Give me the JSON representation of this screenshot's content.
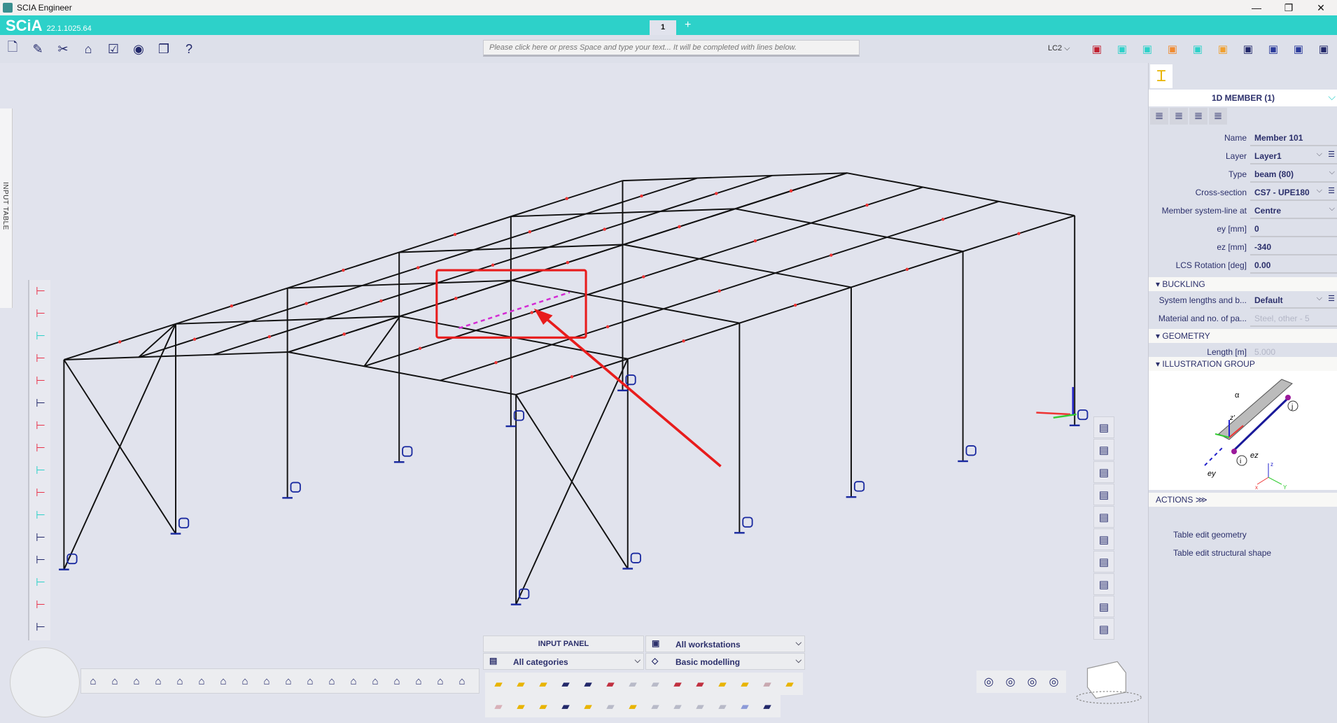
{
  "window": {
    "title": "SCIA Engineer",
    "controls": [
      "—",
      "❐",
      "✕"
    ]
  },
  "brand": {
    "name": "SCiA",
    "version": "22.1.1025.64"
  },
  "tabs": [
    {
      "label": "1"
    },
    {
      "label": "+"
    }
  ],
  "toolbar": {
    "left_icons": [
      "new-document-icon",
      "edit-project-icon",
      "tools-icon",
      "structure-icon",
      "check-icon",
      "view-icon",
      "open-book-icon",
      "help-icon"
    ],
    "command_placeholder": "Please click here or press Space and type your text... It will be completed with lines below.",
    "load_case": "LC2",
    "right_icons": [
      "snap-icon",
      "coords-icon",
      "dimension-icon",
      "refresh-icon",
      "grid-icon",
      "lock-icon",
      "window-icon",
      "eurocode-icon",
      "national-annex-icon",
      "user-icon"
    ]
  },
  "input_table_tab": "INPUT TABLE",
  "left_tools": [
    "node-icon",
    "add-member-icon",
    "insert-node-icon",
    "connect-icon",
    "align-icon",
    "paint-icon",
    "frame-icon",
    "frame-edit-icon",
    "stairs-icon",
    "split-icon",
    "download-icon",
    "layers-icon",
    "cross-section-icon",
    "check-model-icon",
    "delete-icon",
    "lcs-icon"
  ],
  "right_tools": [
    "frame-view-icon",
    "beam-view-icon",
    "person-icon",
    "vertical-arrows-icon",
    "database-icon",
    "member-icon",
    "section-icon",
    "dots-grid-icon",
    "select-check-icon",
    "eye-icon"
  ],
  "properties": {
    "title": "1D MEMBER (1)",
    "tabs": [
      "layers-tab-icon",
      "cross-section-tab-icon",
      "loads-tab-icon",
      "member-tab-icon"
    ],
    "rows": [
      {
        "label": "Name",
        "value": "Member 101"
      },
      {
        "label": "Layer",
        "value": "Layer1",
        "dropdown": true,
        "settings": true
      },
      {
        "label": "Type",
        "value": "beam (80)",
        "dropdown": true
      },
      {
        "label": "Cross-section",
        "value": "CS7 - UPE180",
        "dropdown": true,
        "settings": true
      },
      {
        "label": "Member system-line at",
        "value": "Centre",
        "dropdown": true
      },
      {
        "label": "ey [mm]",
        "value": "0"
      },
      {
        "label": "ez [mm]",
        "value": "-340"
      },
      {
        "label": "LCS Rotation [deg]",
        "value": "0.00"
      }
    ],
    "buckling": {
      "title": "BUCKLING",
      "rows": [
        {
          "label": "System lengths and b...",
          "value": "Default",
          "dropdown": true,
          "settings": true
        },
        {
          "label": "Material and no. of pa...",
          "value": "Steel, other - 5",
          "disabled": true
        }
      ]
    },
    "geometry": {
      "title": "GEOMETRY",
      "rows": [
        {
          "label": "Length [m]",
          "value": "5.000",
          "disabled": true
        }
      ]
    },
    "illustration": {
      "title": "ILLUSTRATION GROUP",
      "labels": {
        "alpha": "α",
        "z": "z'",
        "i": "i",
        "j": "j",
        "ez": "ez",
        "ey": "ey",
        "ax": "x",
        "ay": "Y",
        "az": "z"
      }
    },
    "actions": {
      "title": "ACTIONS",
      "expand": "⋙",
      "items": [
        "Table edit geometry",
        "Table edit structural shape"
      ]
    }
  },
  "input_panel": {
    "title": "INPUT PANEL",
    "workstation": "All workstations",
    "category": "All categories",
    "mode": "Basic modelling",
    "row1": [
      "beam-icon",
      "plate-icon",
      "column-icon",
      "slab-icon",
      "wall-icon",
      "ribbed-icon",
      "opening-icon",
      "subregion-icon",
      "mesh-icon",
      "point-support-icon",
      "line-support-icon",
      "multi-support-icon",
      "surface-support-icon",
      "hinge-icon"
    ],
    "row2": [
      "subsoil-icon",
      "rigid-link-icon",
      "cross-link-icon",
      "point-load-icon",
      "line-load-icon",
      "point-load-surface-icon",
      "surface-load-icon",
      "moment-icon",
      "free-load-icon",
      "thermal-load-icon",
      "free-surface-icon",
      "gradient-icon",
      "embedded-beam-icon"
    ]
  },
  "bottom_left": [
    "add-node-icon",
    "nodes-icon",
    "support-icon",
    "hinge-point-icon",
    "mesh-refine-icon",
    "wall-sup-icon",
    "axis-icon",
    "slab-a-icon",
    "slab-b-icon",
    "slab-c-icon",
    "slab-d-icon",
    "slab-e-icon",
    "slab-f-icon",
    "arch-a-icon",
    "arch-b-icon",
    "table-icon",
    "filter-icon",
    "panel-icon"
  ],
  "view_tools": [
    "zoom-icon",
    "cube-view-icon",
    "render-icon",
    "visibility-icon"
  ],
  "colors": {
    "teal": "#2dd1c9",
    "highlight": "#e81c1c",
    "selected": "#d42bd4",
    "navy": "#22286a"
  }
}
